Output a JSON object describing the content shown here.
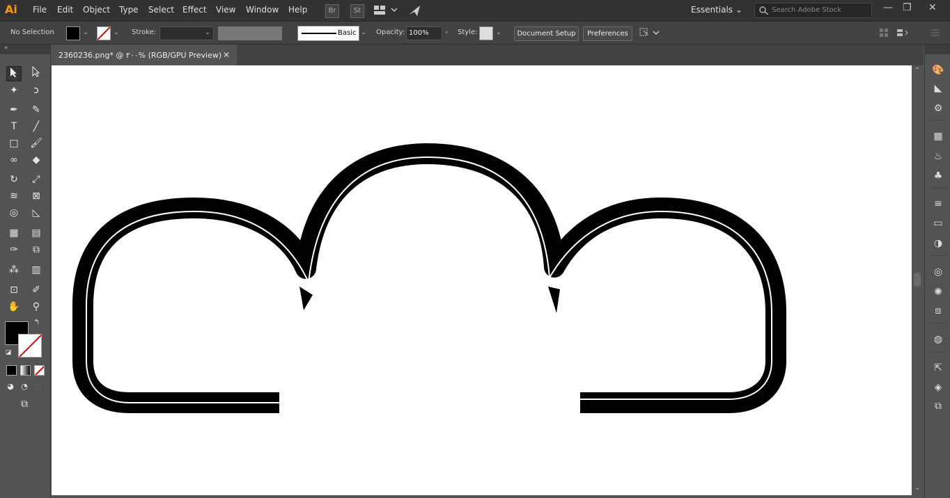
{
  "app": {
    "logo": "Ai"
  },
  "menu": [
    "File",
    "Edit",
    "Object",
    "Type",
    "Select",
    "Effect",
    "View",
    "Window",
    "Help"
  ],
  "app_icons": [
    "Br",
    "St"
  ],
  "workspace": "Essentials",
  "search": {
    "placeholder": "Search Adobe Stock"
  },
  "window_controls": [
    "—",
    "❐",
    "✕"
  ],
  "control_bar": {
    "selection": "No Selection",
    "stroke_label": "Stroke:",
    "brush": "Basic",
    "opacity_label": "Opacity:",
    "opacity_value": "100%",
    "style_label": "Style:",
    "document_setup": "Document Setup",
    "preferences": "Preferences"
  },
  "document_tab": {
    "title": "2360236.png* @ ٢٠٠% (RGB/GPU Preview)",
    "close": "✕"
  },
  "colors": {
    "fill": "#000000",
    "stroke": "none",
    "accent": "#ff9a00"
  },
  "tools": [
    [
      "selection-tool-icon",
      "direct-selection-tool-icon"
    ],
    [
      "magic-wand-tool-icon",
      "lasso-tool-icon"
    ],
    [
      "pen-tool-icon",
      "curvature-tool-icon"
    ],
    [
      "type-tool-icon",
      "line-tool-icon"
    ],
    [
      "rectangle-tool-icon",
      "paintbrush-tool-icon"
    ],
    [
      "shaper-tool-icon",
      "eraser-tool-icon"
    ],
    [
      "rotate-tool-icon",
      "scale-tool-icon"
    ],
    [
      "width-tool-icon",
      "free-transform-tool-icon"
    ],
    [
      "shape-builder-tool-icon",
      "perspective-grid-tool-icon"
    ],
    [
      "mesh-tool-icon",
      "gradient-tool-icon"
    ],
    [
      "eyedropper-tool-icon",
      "blend-tool-icon"
    ],
    [
      "symbol-sprayer-tool-icon",
      "column-graph-tool-icon"
    ],
    [
      "artboard-tool-icon",
      "slice-tool-icon"
    ],
    [
      "hand-tool-icon",
      "zoom-tool-icon"
    ]
  ]
}
